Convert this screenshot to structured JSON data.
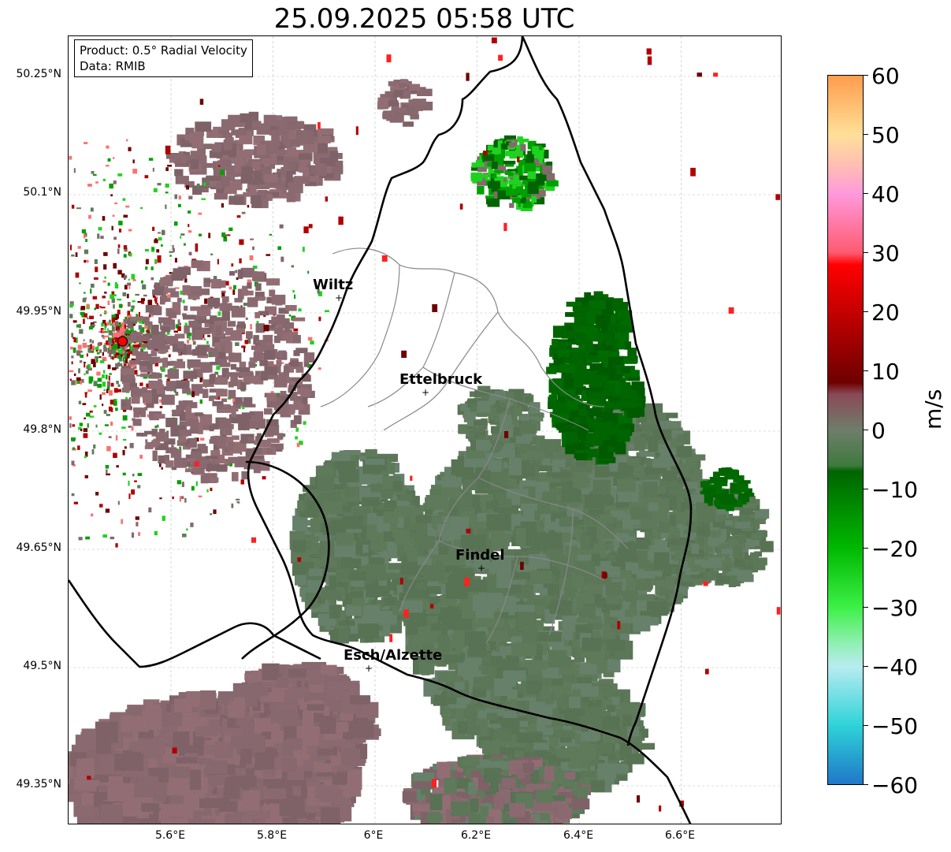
{
  "title": "25.09.2025 05:58 UTC",
  "info_box": {
    "product": "Product: 0.5° Radial Velocity",
    "data": "Data: RMIB"
  },
  "axes": {
    "x_ticks": [
      "5.6°E",
      "5.8°E",
      "6°E",
      "6.2°E",
      "6.4°E",
      "6.6°E"
    ],
    "y_ticks": [
      "50.25°N",
      "50.1°N",
      "49.95°N",
      "49.8°N",
      "49.65°N",
      "49.5°N",
      "49.35°N"
    ]
  },
  "cities": [
    {
      "name": "Wiltz",
      "lon": 5.93,
      "lat": 49.966
    },
    {
      "name": "Ettelbruck",
      "lon": 6.1,
      "lat": 49.847
    },
    {
      "name": "Findel",
      "lon": 6.21,
      "lat": 49.624
    },
    {
      "name": "Esch/Alzette",
      "lon": 5.99,
      "lat": 49.497
    }
  ],
  "radar_site": {
    "lon": 5.505,
    "lat": 49.914
  },
  "colorbar": {
    "unit": "m/s",
    "min": -60,
    "max": 60,
    "tick_labels": [
      "60",
      "50",
      "40",
      "30",
      "20",
      "10",
      "0",
      "−10",
      "−20",
      "−30",
      "−40",
      "−50",
      "−60"
    ],
    "stops": [
      {
        "v": -60,
        "color": "#1f78c8"
      },
      {
        "v": -50,
        "color": "#2ed3d8"
      },
      {
        "v": -40,
        "color": "#b8ecf0"
      },
      {
        "v": -36,
        "color": "#8ef0b0"
      },
      {
        "v": -30,
        "color": "#3cf046"
      },
      {
        "v": -20,
        "color": "#00b800"
      },
      {
        "v": -7,
        "color": "#006400"
      },
      {
        "v": -6,
        "color": "#3f7a3f"
      },
      {
        "v": 0,
        "color": "#6e7e6a"
      },
      {
        "v": 6,
        "color": "#8a4a58"
      },
      {
        "v": 8,
        "color": "#6e0000"
      },
      {
        "v": 28,
        "color": "#ff0000"
      },
      {
        "v": 30,
        "color": "#ff5a70"
      },
      {
        "v": 40,
        "color": "#ff99dd"
      },
      {
        "v": 44,
        "color": "#ffb8b8"
      },
      {
        "v": 50,
        "color": "#ffe098"
      },
      {
        "v": 60,
        "color": "#ff9c4c"
      }
    ]
  },
  "colors": {
    "outbound_dark": "#5f7a5a",
    "outbound_green": "#006400",
    "inbound_mauve": "#86686e",
    "inbound_red": "#b00000"
  }
}
